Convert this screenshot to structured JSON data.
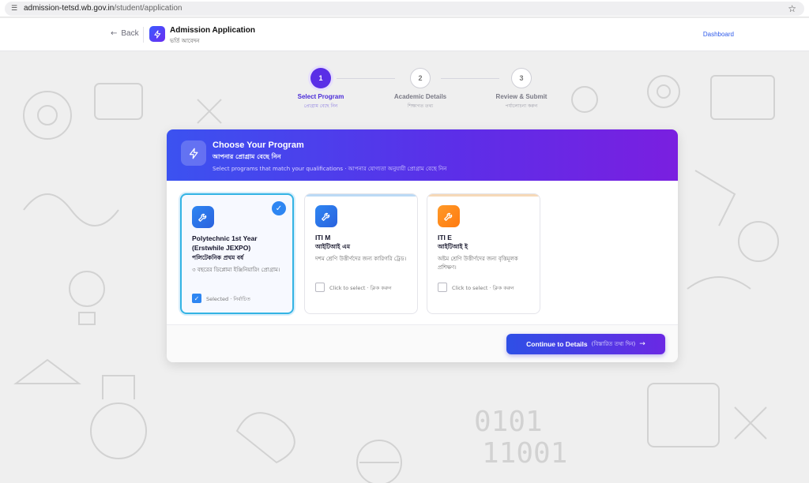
{
  "browser": {
    "url_host": "admission-tetsd.wb.gov.in",
    "url_path": "/student/application",
    "site_icon": "site-settings-icon",
    "star_icon": "bookmark-star-icon"
  },
  "header": {
    "back_label": "Back",
    "title": "Admission Application",
    "subtitle": "ভর্তি আবেদন",
    "dashboard_label": "Dashboard"
  },
  "stepper": {
    "steps": [
      {
        "number": "1",
        "label": "Select Program",
        "sub": "প্রোগ্রাম বেছে নিন",
        "state": "active"
      },
      {
        "number": "2",
        "label": "Academic Details",
        "sub": "শিক্ষাগত তথ্য",
        "state": "todo"
      },
      {
        "number": "3",
        "label": "Review & Submit",
        "sub": "পর্যালোচনা করুন",
        "state": "todo"
      }
    ]
  },
  "card": {
    "title": "Choose Your Program",
    "title_bn": "আপনার প্রোগ্রাম বেছে নিন",
    "description": "Select programs that match your qualifications · আপনার যোগ্যতা অনুযায়ী প্রোগ্রাম বেছে নিন",
    "options": [
      {
        "name": "Polytechnic 1st Year (Erstwhile JEXPO)",
        "name_bn": "পলিটেকনিক প্রথম বর্ষ",
        "desc_bn": "৩ বছরের ডিপ্লোমা ইঞ্জিনিয়ারিং প্রোগ্রাম।",
        "status": "Selected · নির্বাচিত",
        "selected": true,
        "icon": "wrench-icon",
        "color": "#2e86f2"
      },
      {
        "name": "ITI M",
        "name_bn": "আইটিআই এম",
        "desc_bn": "দশম শ্রেণি উত্তীর্ণদের জন্য কারিগরি ট্রেড।",
        "status": "Click to select · ক্লিক করুন",
        "selected": false,
        "icon": "wrench-icon",
        "color": "#2e86f2"
      },
      {
        "name": "ITI E",
        "name_bn": "আইটিআই ই",
        "desc_bn": "অষ্টম শ্রেণি উত্তীর্ণদের জন্য বৃত্তিমূলক প্রশিক্ষণ।",
        "status": "Click to select · ক্লিক করুন",
        "selected": false,
        "icon": "wrench-icon",
        "color": "#ff8a1c"
      }
    ],
    "continue_label": "Continue to Details",
    "continue_label_bn": "(বিস্তারিত তথ্য দিন)"
  },
  "colors": {
    "accent": "#5a2ee6",
    "header_gradient_start": "#3b52f0",
    "header_gradient_end": "#7a1fe0",
    "selected_border": "#34b4e4"
  }
}
